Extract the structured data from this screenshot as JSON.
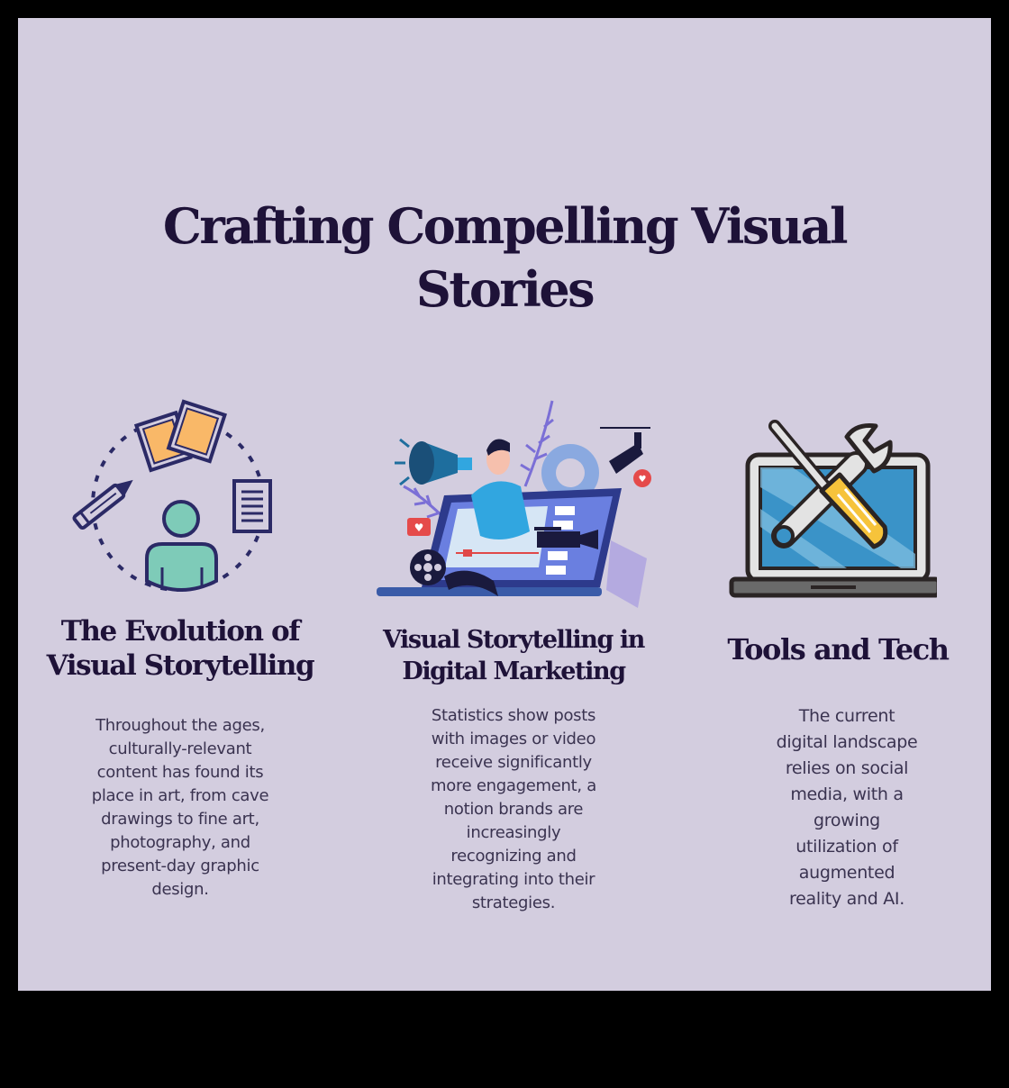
{
  "colors": {
    "page_background": "#000000",
    "panel_background": "#d3cddf",
    "heading": "#1e1238",
    "body_text": "#3a3350",
    "icon_outline": "#2b2a66",
    "icon_teal": "#7ecbb8",
    "icon_orange": "#f9b868",
    "icon_blue": "#3a93c8",
    "icon_yellow": "#f6c33b"
  },
  "title": {
    "lines": [
      "Crafting Compelling Visual",
      "Stories"
    ]
  },
  "sections": [
    {
      "icon": "storytelling-cycle-icon",
      "heading_lines": [
        "The Evolution of",
        "Visual Storytelling"
      ],
      "body_lines": [
        "Throughout the ages,",
        "culturally-relevant",
        "content has found its",
        "place in art, from cave",
        "drawings to fine art,",
        "photography, and",
        "present-day graphic",
        "design."
      ]
    },
    {
      "icon": "digital-marketing-illustration",
      "heading_lines": [
        "Visual Storytelling in",
        "Digital Marketing"
      ],
      "body_lines": [
        "Statistics show posts",
        "with images or video",
        "receive significantly",
        "more engagement, a",
        "notion brands are",
        "increasingly",
        "recognizing and",
        "integrating into their",
        "strategies."
      ]
    },
    {
      "icon": "laptop-tools-icon",
      "heading_lines": [
        "Tools and Tech"
      ],
      "body_lines": [
        "The current",
        "digital landscape",
        "relies on social",
        "media, with a",
        "growing",
        "utilization of",
        "augmented",
        "reality and AI."
      ]
    }
  ]
}
